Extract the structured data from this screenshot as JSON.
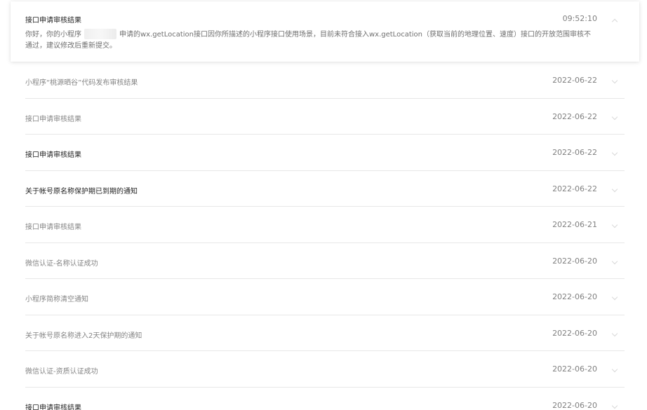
{
  "expanded": {
    "title": "接口申请审核结果",
    "time": "09:52:10",
    "body_prefix": "你好，你的小程序",
    "body_suffix": "申请的wx.getLocation接口因你所描述的小程序接口使用场景，目前未符合接入wx.getLocation（获取当前的地理位置、速度）接口的开放范围审核不通过，建议修改后重新提交。"
  },
  "messages": [
    {
      "title": "小程序“桃源晒谷”代码发布审核结果",
      "date": "2022-06-22"
    },
    {
      "title": "接口申请审核结果",
      "date": "2022-06-22"
    },
    {
      "title": "接口申请审核结果",
      "date": "2022-06-22"
    },
    {
      "title": "关于帐号原名称保护期已到期的通知",
      "date": "2022-06-22"
    },
    {
      "title": "接口申请审核结果",
      "date": "2022-06-21"
    },
    {
      "title": "微信认证-名称认证成功",
      "date": "2022-06-20"
    },
    {
      "title": "小程序简称清空通知",
      "date": "2022-06-20"
    },
    {
      "title": "关于帐号原名称进入2天保护期的通知",
      "date": "2022-06-20"
    },
    {
      "title": "微信认证-资质认证成功",
      "date": "2022-06-20"
    },
    {
      "title": "接口申请审核结果",
      "date": "2022-06-20"
    }
  ],
  "icons": {
    "expanded_toggle": "chevron-up-icon",
    "row_toggle": "chevron-down-icon"
  },
  "colors": {
    "unread_title": "#222222",
    "read_title": "#858585",
    "date": "#808080",
    "divider": "#e7e7e7"
  }
}
